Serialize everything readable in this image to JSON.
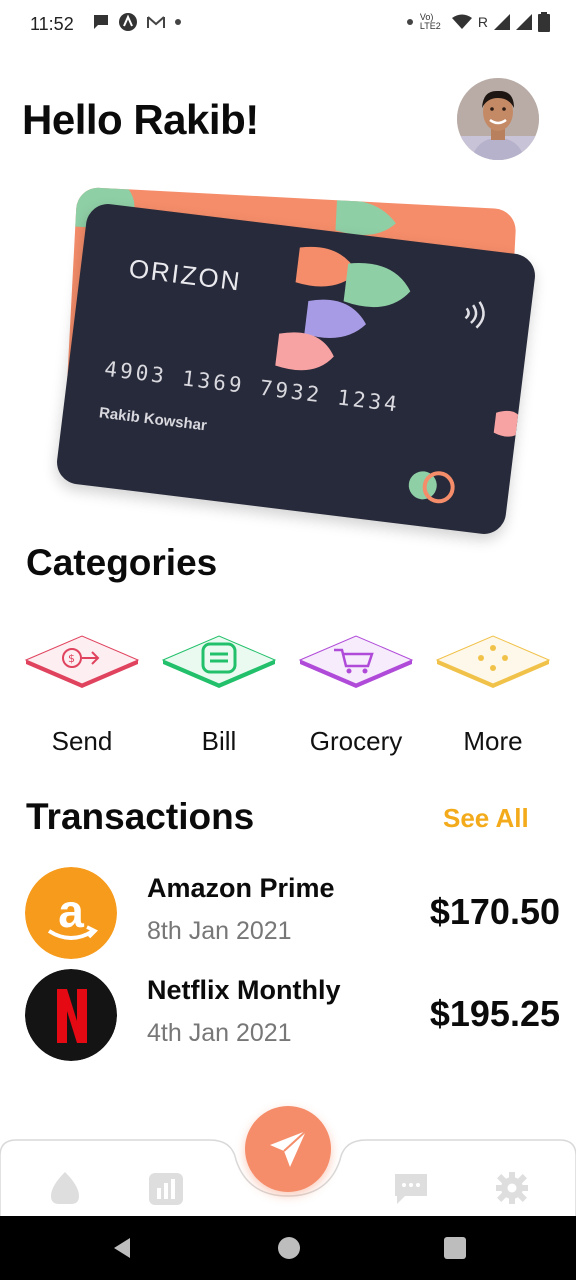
{
  "status_bar": {
    "time": "11:52",
    "carrier_tag": "Vo) LTE2",
    "roaming": "R"
  },
  "header": {
    "greeting": "Hello Rakib!"
  },
  "card": {
    "brand": "ORIZON",
    "number": "4903 1369 7932 1234",
    "holder": "Rakib Kowshar"
  },
  "categories": {
    "title": "Categories",
    "items": [
      {
        "label": "Send",
        "icon": "send-money-icon",
        "color": "#e0435e"
      },
      {
        "label": "Bill",
        "icon": "bill-icon",
        "color": "#22c06a"
      },
      {
        "label": "Grocery",
        "icon": "cart-icon",
        "color": "#b04ad9"
      },
      {
        "label": "More",
        "icon": "more-dots-icon",
        "color": "#f1c24a"
      }
    ]
  },
  "transactions": {
    "title": "Transactions",
    "see_all": "See All",
    "items": [
      {
        "name": "Amazon Prime",
        "date": "8th Jan 2021",
        "amount": "$170.50",
        "logo": "amazon-logo"
      },
      {
        "name": "Netflix Monthly",
        "date": "4th Jan 2021",
        "amount": "$195.25",
        "logo": "netflix-logo"
      }
    ]
  },
  "bottom_nav": {
    "items": [
      "home-icon",
      "stats-icon",
      "send-fab-icon",
      "chat-icon",
      "settings-icon"
    ]
  },
  "colors": {
    "accent": "#f58d6a",
    "see_all": "#f3ab1b",
    "card_dark": "#272a3a"
  }
}
